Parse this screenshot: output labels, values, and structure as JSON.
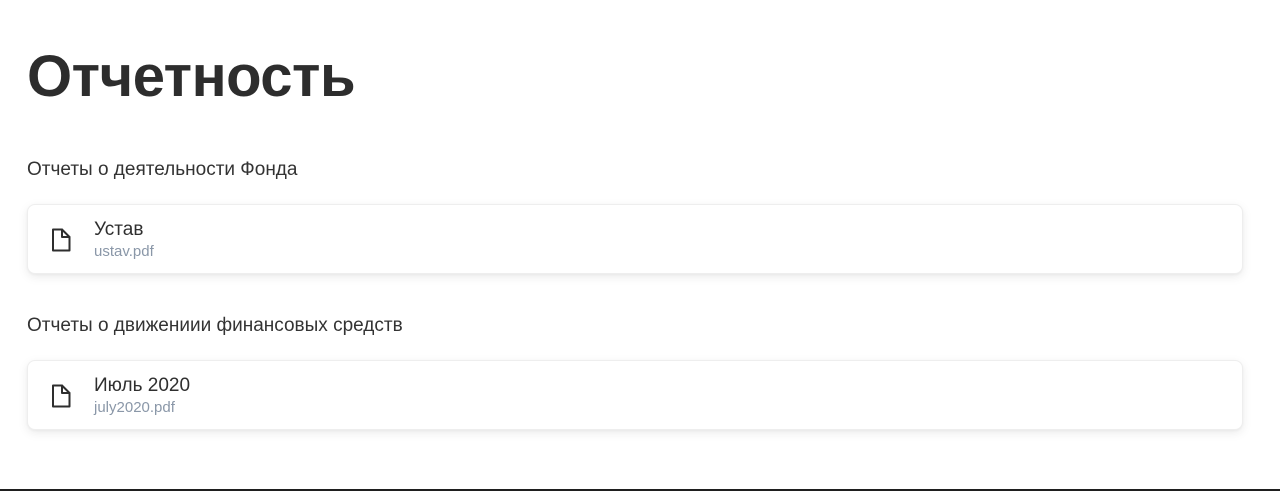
{
  "page": {
    "title": "Отчетность"
  },
  "sections": [
    {
      "title": "Отчеты о деятельности Фонда",
      "files": [
        {
          "name": "Устав",
          "filename": "ustav.pdf",
          "icon": "document-icon"
        }
      ]
    },
    {
      "title": "Отчеты о движениии финансовых средств",
      "files": [
        {
          "name": "Июль 2020",
          "filename": "july2020.pdf",
          "icon": "document-icon"
        }
      ]
    }
  ],
  "colors": {
    "text": "#2d2d2d",
    "muted": "#8a97a8",
    "card_border": "#eeeeee"
  }
}
